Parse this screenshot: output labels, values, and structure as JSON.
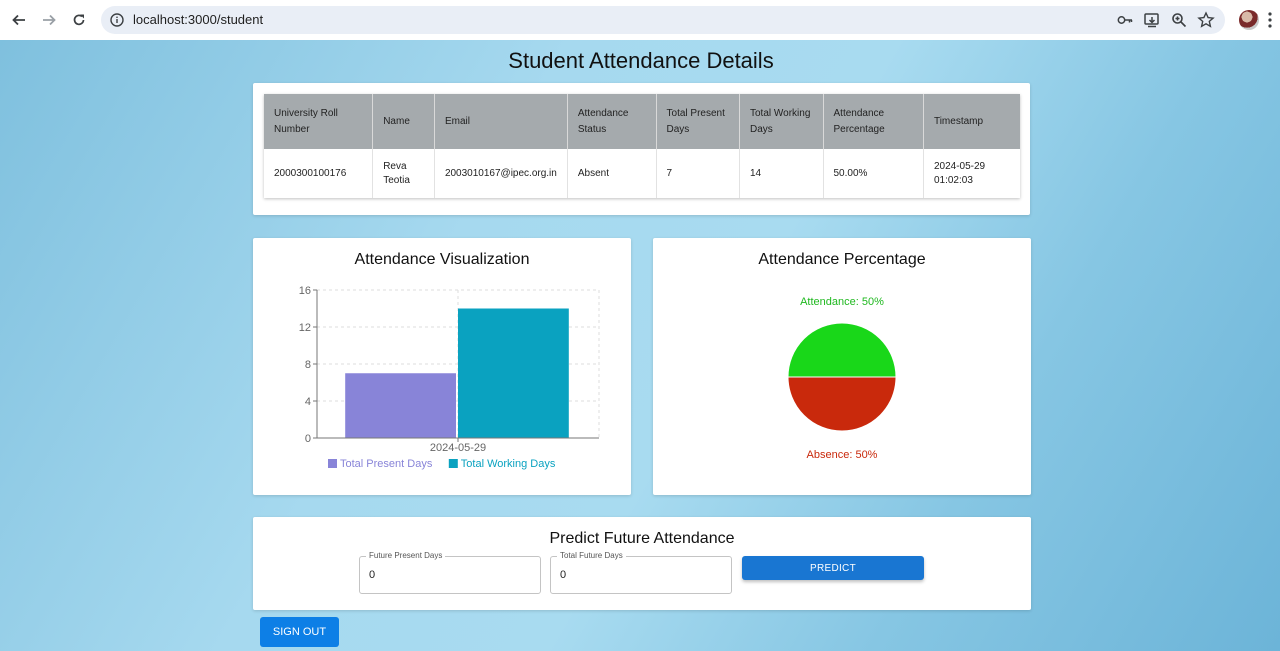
{
  "browser": {
    "url": "localhost:3000/student"
  },
  "page": {
    "title": "Student Attendance Details"
  },
  "table": {
    "headers": [
      "University Roll Number",
      "Name",
      "Email",
      "Attendance Status",
      "Total Present Days",
      "Total Working Days",
      "Attendance Percentage",
      "Timestamp"
    ],
    "rows": [
      [
        "2000300100176",
        "Reva Teotia",
        "2003010167@ipec.org.in",
        "Absent",
        "7",
        "14",
        "50.00%",
        "2024-05-29 01:02:03"
      ]
    ]
  },
  "bar_chart": {
    "title": "Attendance Visualization"
  },
  "pie_chart": {
    "title": "Attendance Percentage"
  },
  "chart_data": [
    {
      "type": "bar",
      "title": "Attendance Visualization",
      "categories": [
        "2024-05-29"
      ],
      "series": [
        {
          "name": "Total Present Days",
          "values": [
            7
          ],
          "color": "#8884d8"
        },
        {
          "name": "Total Working Days",
          "values": [
            14
          ],
          "color": "#0aa2c0"
        }
      ],
      "yticks": [
        "0",
        "4",
        "8",
        "12",
        "16"
      ],
      "ylim": [
        0,
        16
      ],
      "grid": true,
      "legend": "bottom"
    },
    {
      "type": "pie",
      "title": "Attendance Percentage",
      "slices": [
        {
          "label": "Attendance: 50%",
          "value": 50,
          "color": "#19d719"
        },
        {
          "label": "Absence: 50%",
          "value": 50,
          "color": "#c9290c"
        }
      ]
    }
  ],
  "predict": {
    "title": "Predict Future Attendance",
    "future_present_label": "Future Present Days",
    "future_present_value": "0",
    "total_future_label": "Total Future Days",
    "total_future_value": "0",
    "button_label": "PREDICT"
  },
  "signout_label": "SIGN OUT",
  "colors": {
    "predict_button": "#1976d2",
    "signout_button": "#0d7fe6",
    "table_header": "#a5aaad"
  }
}
